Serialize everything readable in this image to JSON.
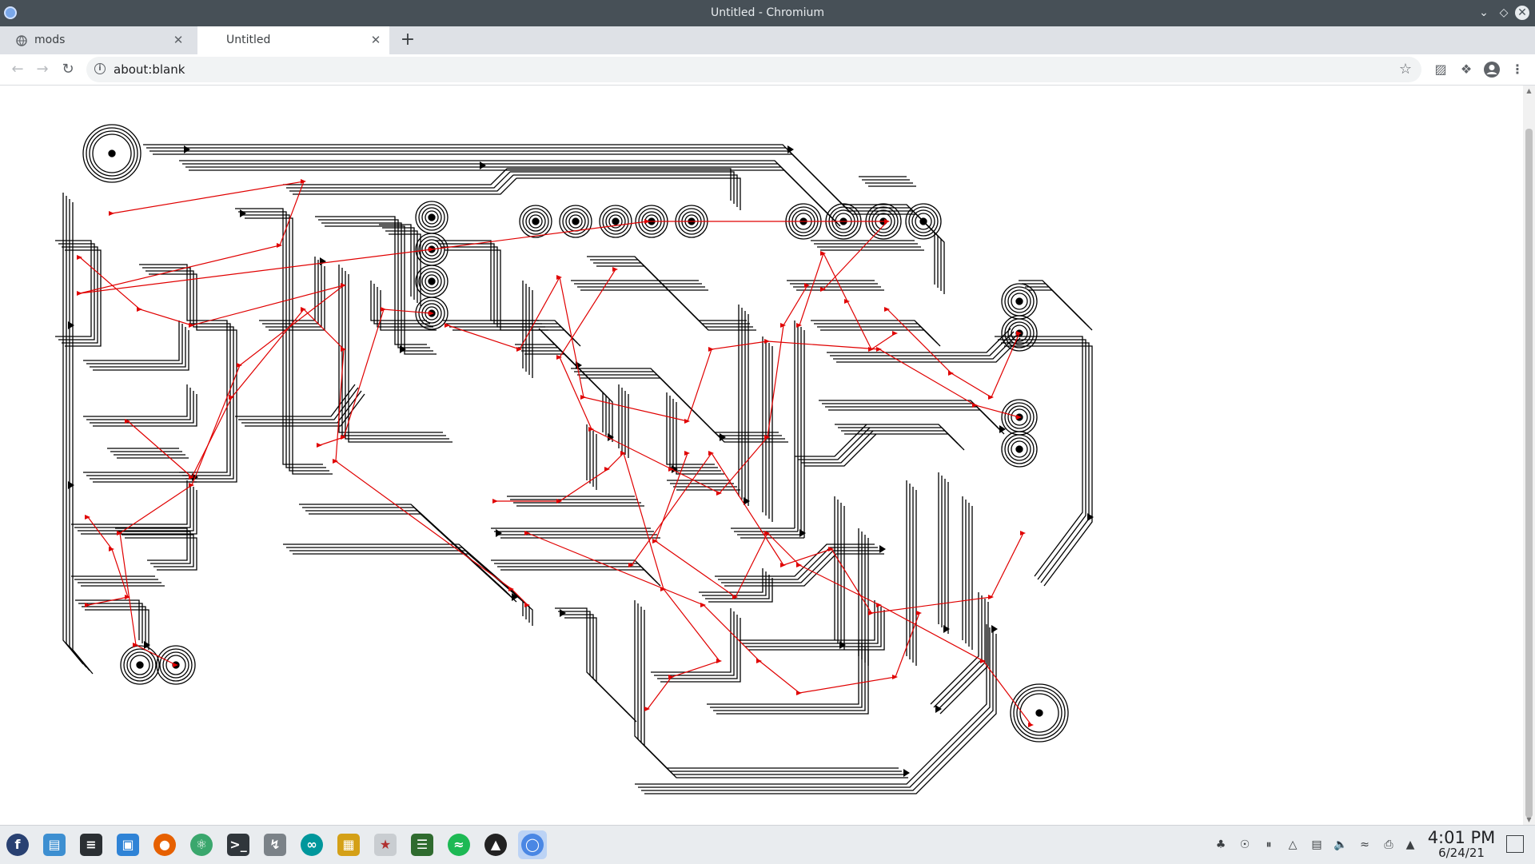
{
  "window": {
    "title": "Untitled - Chromium"
  },
  "tabs": [
    {
      "label": "mods",
      "active": false
    },
    {
      "label": "Untitled",
      "active": true
    }
  ],
  "toolbar": {
    "url": "about:blank"
  },
  "taskbar": {
    "apps": [
      "fedora",
      "file-manager",
      "terminal-dark",
      "software-center",
      "firefox",
      "atom",
      "terminal",
      "thermometer",
      "arduino",
      "kicad",
      "pcb-editor",
      "gerber-viewer",
      "spotify",
      "inkscape",
      "chromium"
    ],
    "clock": {
      "time": "4:01 PM",
      "date": "6/24/21"
    }
  },
  "colors": {
    "traces": "#000000",
    "ratsnest": "#e00000",
    "titlebar": "#475057",
    "tabstrip": "#dee1e6"
  }
}
